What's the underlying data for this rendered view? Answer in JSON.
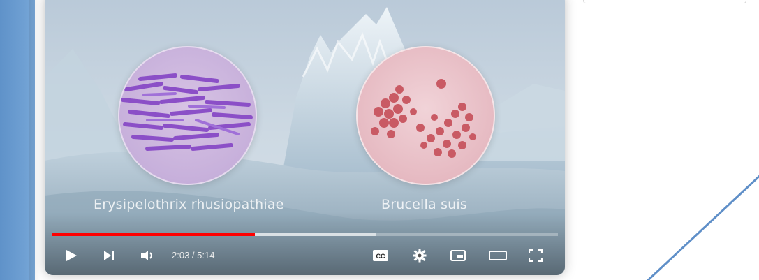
{
  "video": {
    "caption_left": "Erysipelothrix rhusiopathiae",
    "caption_right": "Brucella suis",
    "time_display": "2:03 / 5:14",
    "progress_played_fraction": 0.4,
    "progress_buffered_fraction": 0.64
  },
  "controls": {
    "play_icon": "play-icon",
    "next_icon": "next-icon",
    "volume_icon": "volume-icon",
    "captions_label": "CC",
    "settings_icon": "gear-icon",
    "miniplayer_icon": "miniplayer-icon",
    "theater_icon": "theater-icon",
    "fullscreen_icon": "fullscreen-icon"
  },
  "colors": {
    "progress_played": "#ff0000",
    "page_accent": "#6a9bd1"
  }
}
